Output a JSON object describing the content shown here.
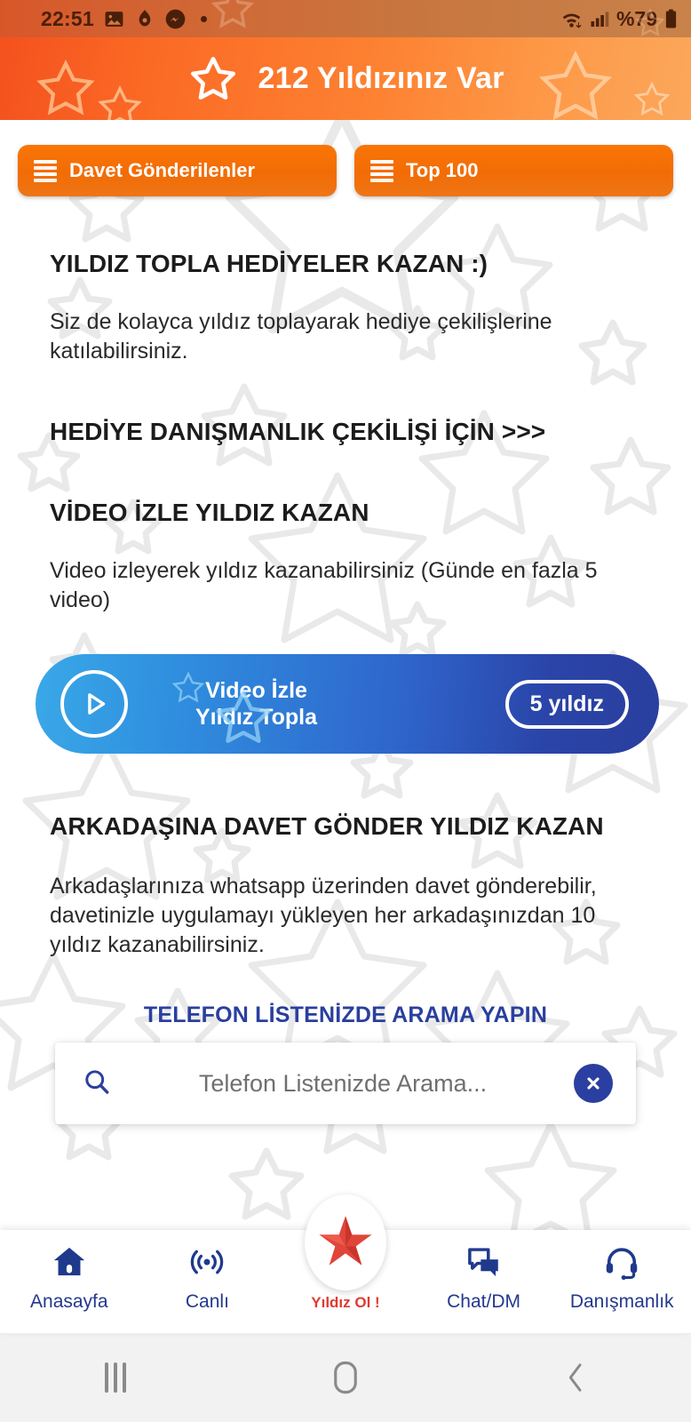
{
  "status_bar": {
    "time": "22:51",
    "left_icons": [
      "gallery-icon",
      "flame-icon",
      "messenger-icon",
      "dot-indicator"
    ],
    "battery_percent": "%79",
    "right_icons": [
      "wifi-icon",
      "cellular-signal-icon",
      "battery-icon"
    ]
  },
  "header": {
    "title": "212 Yıldızınız Var",
    "star_icon": "star-outline-icon",
    "gradient_from": "#f4511e",
    "gradient_to": "#fca75b"
  },
  "tabs": [
    {
      "label": "Davet Gönderilenler",
      "icon": "list-icon"
    },
    {
      "label": "Top 100",
      "icon": "list-icon"
    }
  ],
  "sections": {
    "collect": {
      "title": "YILDIZ TOPLA HEDİYELER KAZAN :)",
      "body": "Siz de kolayca yıldız toplayarak hediye çekilişlerine katılabilirsiniz."
    },
    "raffle_link": {
      "title": "HEDİYE DANIŞMANLIK ÇEKİLİŞİ İÇİN >>>"
    },
    "video": {
      "title": "VİDEO İZLE YILDIZ KAZAN",
      "body": "Video izleyerek yıldız kazanabilirsiniz (Günde en fazla 5 video)"
    },
    "invite": {
      "title": "ARKADAŞINA DAVET GÖNDER YILDIZ KAZAN",
      "body": "Arkadaşlarınıza whatsapp üzerinden davet gönderebilir, davetinizle uygulamayı yükleyen her arkadaşınızdan 10 yıldız kazanabilirsiniz."
    }
  },
  "video_banner": {
    "line1": "Video İzle",
    "line2": "Yıldız Topla",
    "reward": "5 yıldız",
    "play_icon": "play-circle-icon",
    "gradient_from": "#3aa8e8",
    "gradient_to": "#2a3f9e"
  },
  "search": {
    "heading": "TELEFON LİSTENİZDE ARAMA YAPIN",
    "placeholder": "Telefon Listenizde Arama...",
    "value": "",
    "search_icon": "search-icon",
    "clear_icon": "close-circle-icon",
    "accent": "#2a3f9e"
  },
  "bottom_nav": {
    "accent": "#23388f",
    "items": [
      {
        "label": "Anasayfa",
        "icon": "home-icon"
      },
      {
        "label": "Canlı",
        "icon": "broadcast-icon"
      },
      {
        "label": "Yıldız Ol !",
        "icon": "red-star-icon"
      },
      {
        "label": "Chat/DM",
        "icon": "chat-bubbles-icon"
      },
      {
        "label": "Danışmanlık",
        "icon": "headset-icon"
      }
    ]
  },
  "android_nav": {
    "buttons": [
      {
        "name": "recents",
        "icon": "recents-icon"
      },
      {
        "name": "home",
        "icon": "home-square-icon"
      },
      {
        "name": "back",
        "icon": "back-chevron-icon"
      }
    ]
  }
}
